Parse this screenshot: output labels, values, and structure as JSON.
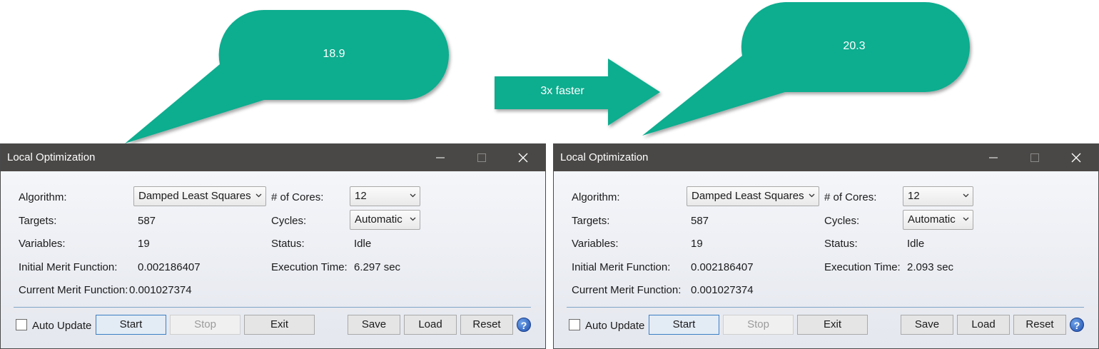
{
  "annotations": {
    "left_bubble": "18.9",
    "right_bubble": "20.3",
    "arrow_label": "3x faster",
    "callout_color": "#0aad8f"
  },
  "windows": [
    {
      "title": "Local Optimization",
      "algorithm_label": "Algorithm:",
      "algorithm_value": "Damped Least Squares",
      "cores_label": "# of Cores:",
      "cores_value": "12",
      "targets_label": "Targets:",
      "targets_value": "587",
      "cycles_label": "Cycles:",
      "cycles_value": "Automatic",
      "variables_label": "Variables:",
      "variables_value": "19",
      "status_label": "Status:",
      "status_value": "Idle",
      "initial_merit_label": "Initial Merit Function:",
      "initial_merit_value": "0.002186407",
      "execution_label": "Execution Time:",
      "execution_value": "6.297 sec",
      "current_merit_label": "Current Merit Function:",
      "current_merit_value": "0.001027374",
      "auto_update_label": "Auto Update",
      "auto_update_checked": false,
      "start_label": "Start",
      "stop_label": "Stop",
      "exit_label": "Exit",
      "save_label": "Save",
      "load_label": "Load",
      "reset_label": "Reset",
      "help_icon": "help-question-icon"
    },
    {
      "title": "Local Optimization",
      "algorithm_label": "Algorithm:",
      "algorithm_value": "Damped Least Squares",
      "cores_label": "# of Cores:",
      "cores_value": "12",
      "targets_label": "Targets:",
      "targets_value": "587",
      "cycles_label": "Cycles:",
      "cycles_value": "Automatic",
      "variables_label": "Variables:",
      "variables_value": "19",
      "status_label": "Status:",
      "status_value": "Idle",
      "initial_merit_label": "Initial Merit Function:",
      "initial_merit_value": "0.002186407",
      "execution_label": "Execution Time:",
      "execution_value": "2.093 sec",
      "current_merit_label": "Current Merit Function:",
      "current_merit_value": "0.001027374",
      "auto_update_label": "Auto Update",
      "auto_update_checked": false,
      "start_label": "Start",
      "stop_label": "Stop",
      "exit_label": "Exit",
      "save_label": "Save",
      "load_label": "Load",
      "reset_label": "Reset",
      "help_icon": "help-question-icon"
    }
  ]
}
